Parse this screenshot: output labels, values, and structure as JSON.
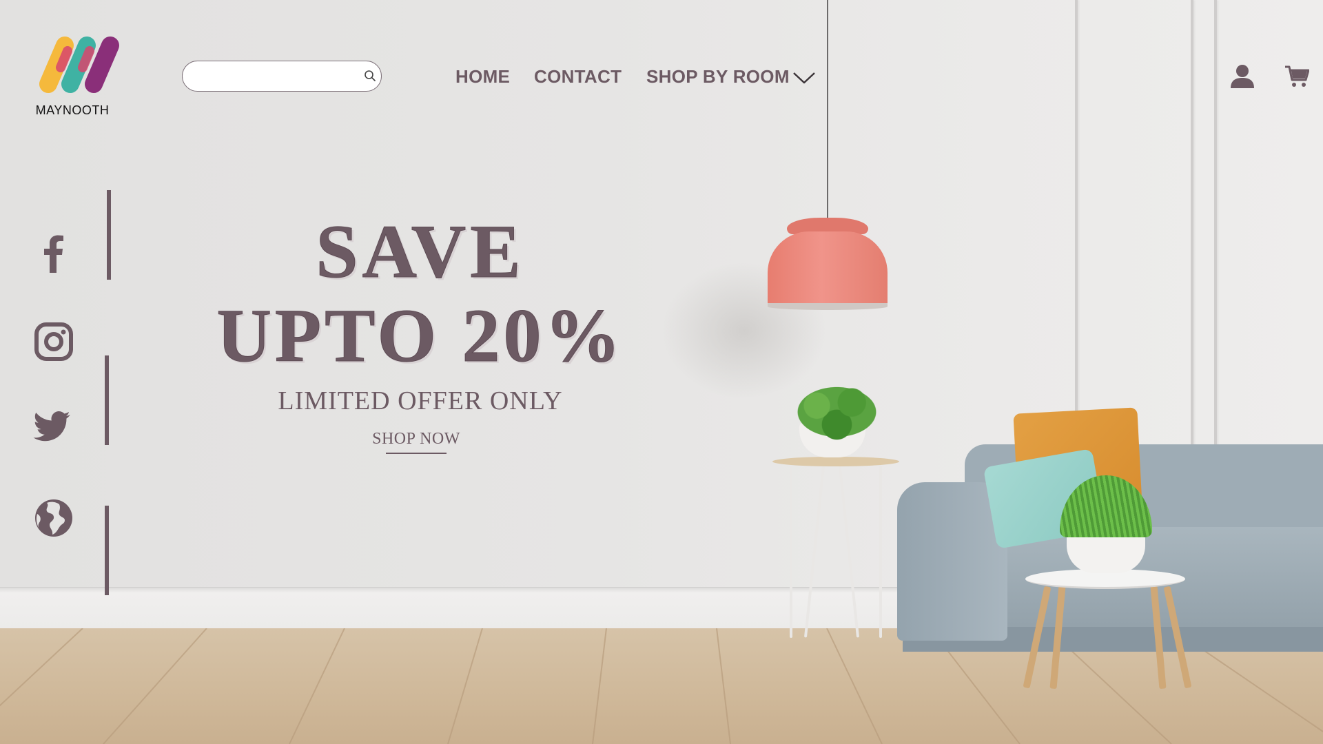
{
  "brand": {
    "name": "MAYNOOTH",
    "colors": {
      "yellow": "#f5b93c",
      "teal": "#3fb2a3",
      "pink": "#d8476e",
      "purple": "#8a2f79"
    }
  },
  "search": {
    "placeholder": "",
    "value": "",
    "icon": "search-icon"
  },
  "nav": {
    "home": "HOME",
    "contact": "CONTACT",
    "shop_by_room": "SHOP BY ROOM",
    "dropdown_icon": "chevron-down-icon"
  },
  "header_icons": {
    "account": "user-icon",
    "cart": "cart-icon"
  },
  "social": [
    "facebook-icon",
    "instagram-icon",
    "twitter-icon",
    "globe-icon"
  ],
  "hero": {
    "line1": "SAVE",
    "line2": "UPTO 20%",
    "subtitle": "LIMITED OFFER ONLY",
    "cta": "SHOP NOW"
  },
  "theme": {
    "text": "#6c5a63",
    "wall": "#e4e3e2"
  }
}
